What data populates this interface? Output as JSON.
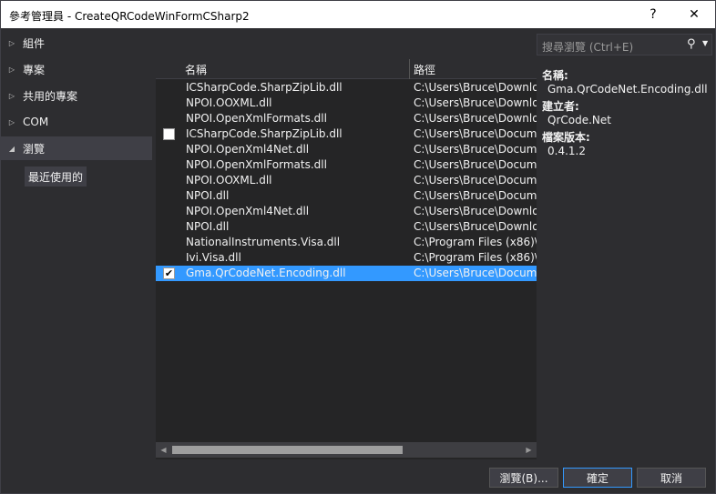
{
  "window": {
    "title": "參考管理員 - CreateQRCodeWinFormCSharp2",
    "help_label": "?",
    "close_label": "✕"
  },
  "nav": {
    "items": [
      {
        "label": "組件",
        "arrow": "▷",
        "selected": false
      },
      {
        "label": "專案",
        "arrow": "▷",
        "selected": false
      },
      {
        "label": "共用的專案",
        "arrow": "▷",
        "selected": false
      },
      {
        "label": "COM",
        "arrow": "▷",
        "selected": false
      },
      {
        "label": "瀏覽",
        "arrow": "◢",
        "selected": true
      }
    ],
    "sub_item": "最近使用的"
  },
  "list": {
    "columns": {
      "name": "名稱",
      "path": "路徑"
    },
    "rows": [
      {
        "name": "ICSharpCode.SharpZipLib.dll",
        "path": "C:\\Users\\Bruce\\Downloads",
        "check": "none",
        "selected": false
      },
      {
        "name": "NPOI.OOXML.dll",
        "path": "C:\\Users\\Bruce\\Downloads",
        "check": "none",
        "selected": false
      },
      {
        "name": "NPOI.OpenXmlFormats.dll",
        "path": "C:\\Users\\Bruce\\Downloads",
        "check": "none",
        "selected": false
      },
      {
        "name": "ICSharpCode.SharpZipLib.dll",
        "path": "C:\\Users\\Bruce\\Documents",
        "check": "unchecked",
        "selected": false
      },
      {
        "name": "NPOI.OpenXml4Net.dll",
        "path": "C:\\Users\\Bruce\\Documents",
        "check": "none",
        "selected": false
      },
      {
        "name": "NPOI.OpenXmlFormats.dll",
        "path": "C:\\Users\\Bruce\\Documents",
        "check": "none",
        "selected": false
      },
      {
        "name": "NPOI.OOXML.dll",
        "path": "C:\\Users\\Bruce\\Documents",
        "check": "none",
        "selected": false
      },
      {
        "name": "NPOI.dll",
        "path": "C:\\Users\\Bruce\\Documents",
        "check": "none",
        "selected": false
      },
      {
        "name": "NPOI.OpenXml4Net.dll",
        "path": "C:\\Users\\Bruce\\Downloads",
        "check": "none",
        "selected": false
      },
      {
        "name": "NPOI.dll",
        "path": "C:\\Users\\Bruce\\Downloads",
        "check": "none",
        "selected": false
      },
      {
        "name": "NationalInstruments.Visa.dll",
        "path": "C:\\Program Files (x86)\\",
        "check": "none",
        "selected": false
      },
      {
        "name": "Ivi.Visa.dll",
        "path": "C:\\Program Files (x86)\\",
        "check": "none",
        "selected": false
      },
      {
        "name": "Gma.QrCodeNet.Encoding.dll",
        "path": "C:\\Users\\Bruce\\Documents",
        "check": "checked",
        "selected": true
      }
    ]
  },
  "search": {
    "placeholder": "搜尋瀏覽 (Ctrl+E)",
    "icon": "search-icon"
  },
  "details": {
    "name_label": "名稱:",
    "name_value": "Gma.QrCodeNet.Encoding.dll",
    "creator_label": "建立者:",
    "creator_value": "QrCode.Net",
    "version_label": "檔案版本:",
    "version_value": "0.4.1.2"
  },
  "buttons": {
    "browse": "瀏覽(B)...",
    "ok": "確定",
    "cancel": "取消"
  },
  "colors": {
    "background": "#2d2d30",
    "list_background": "#252526",
    "selection": "#3399ff"
  }
}
